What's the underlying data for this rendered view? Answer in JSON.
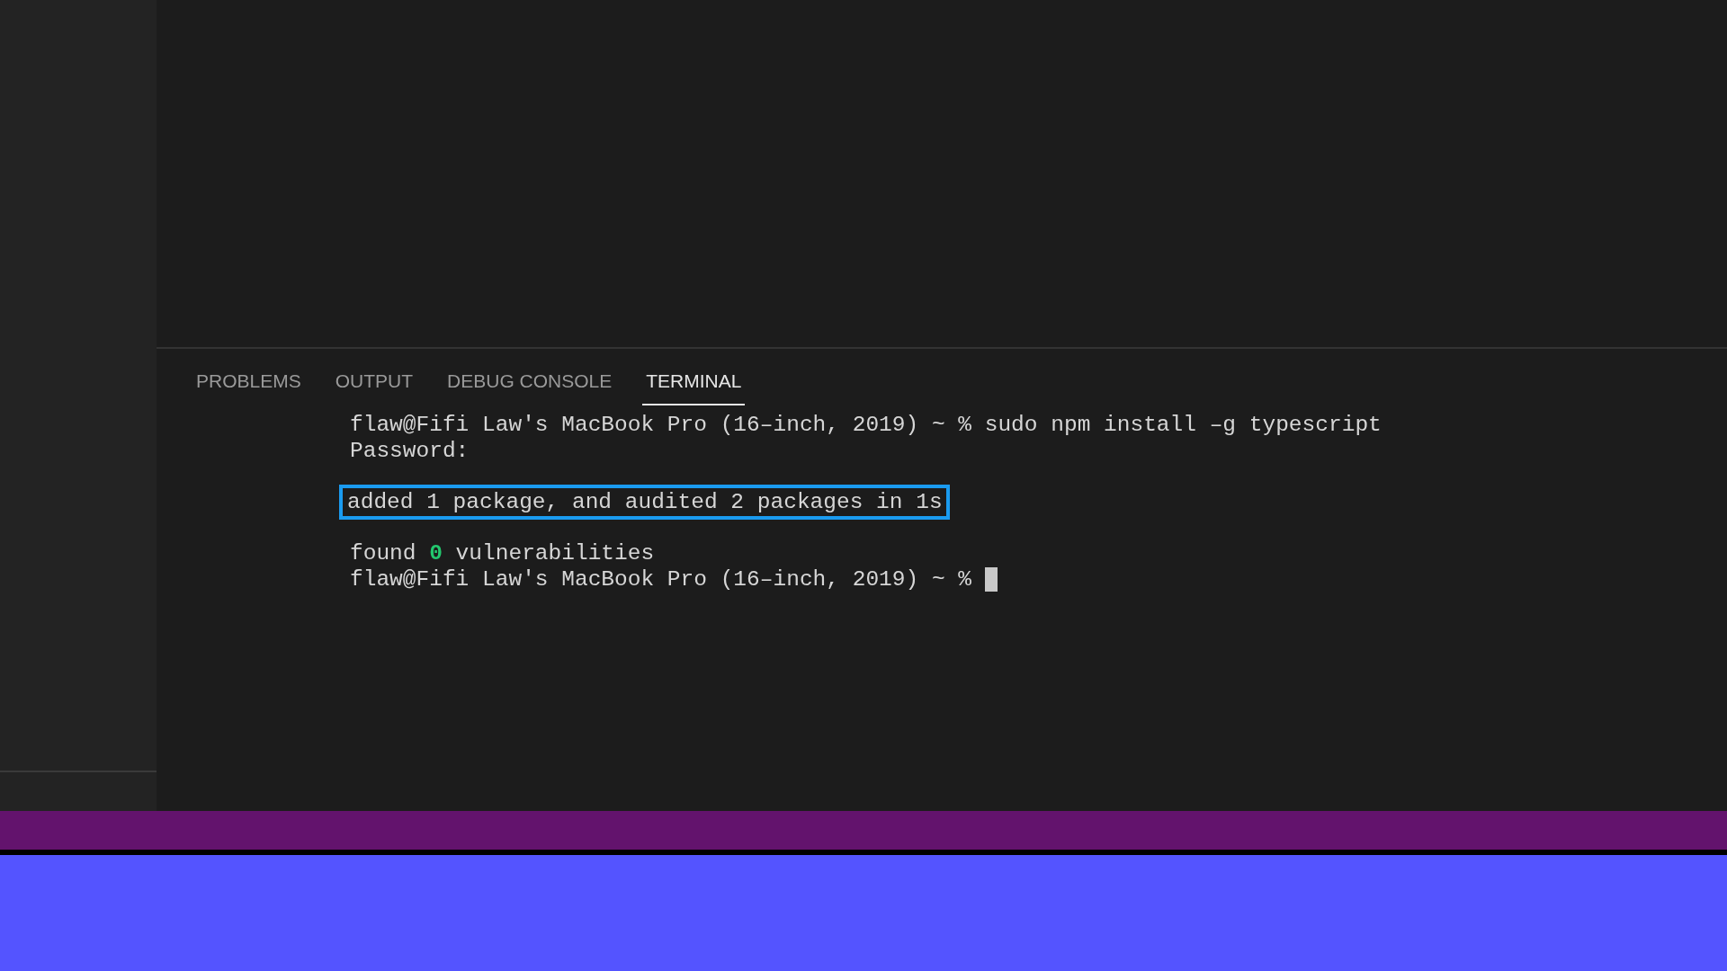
{
  "panel": {
    "tabs": [
      {
        "label": "PROBLEMS",
        "selected": false
      },
      {
        "label": "OUTPUT",
        "selected": false
      },
      {
        "label": "DEBUG CONSOLE",
        "selected": false
      },
      {
        "label": "TERMINAL",
        "selected": true
      }
    ]
  },
  "terminal": {
    "blocks": [
      {
        "kind": "plain",
        "lines": [
          {
            "parts": [
              {
                "text": "flaw@Fifi Law's MacBook Pro (16–inch, 2019) ~ % sudo npm install –g typescript"
              }
            ]
          },
          {
            "parts": [
              {
                "text": "Password:"
              }
            ]
          }
        ]
      },
      {
        "kind": "highlighted",
        "lines": [
          {
            "parts": [
              {
                "text": "added 1 package, and audited 2 packages in 1s"
              }
            ]
          }
        ]
      },
      {
        "kind": "plain",
        "lines": [
          {
            "parts": [
              {
                "text": "found "
              },
              {
                "text": "0",
                "kind": "number"
              },
              {
                "text": " vulnerabilities"
              }
            ]
          },
          {
            "parts": [
              {
                "text": "flaw@Fifi Law's MacBook Pro (16–inch, 2019) ~ % "
              }
            ],
            "cursor": true
          }
        ]
      }
    ]
  }
}
